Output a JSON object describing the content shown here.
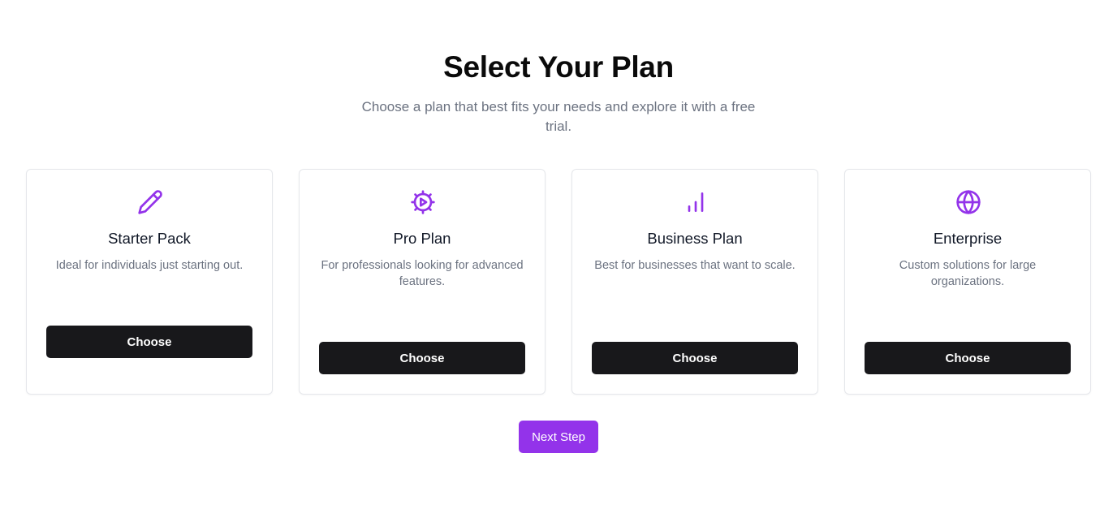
{
  "header": {
    "title": "Select Your Plan",
    "subtitle": "Choose a plan that best fits your needs and explore it with a free trial."
  },
  "theme": {
    "accent": "#9333ea",
    "button_dark": "#18181b"
  },
  "plans": [
    {
      "icon": "pencil-icon",
      "name": "Starter Pack",
      "description": "Ideal for individuals just starting out.",
      "button_label": "Choose"
    },
    {
      "icon": "gear-play-icon",
      "name": "Pro Plan",
      "description": "For professionals looking for advanced features.",
      "button_label": "Choose"
    },
    {
      "icon": "bar-chart-icon",
      "name": "Business Plan",
      "description": "Best for businesses that want to scale.",
      "button_label": "Choose"
    },
    {
      "icon": "globe-icon",
      "name": "Enterprise",
      "description": "Custom solutions for large organizations.",
      "button_label": "Choose"
    }
  ],
  "footer": {
    "next_label": "Next Step"
  }
}
